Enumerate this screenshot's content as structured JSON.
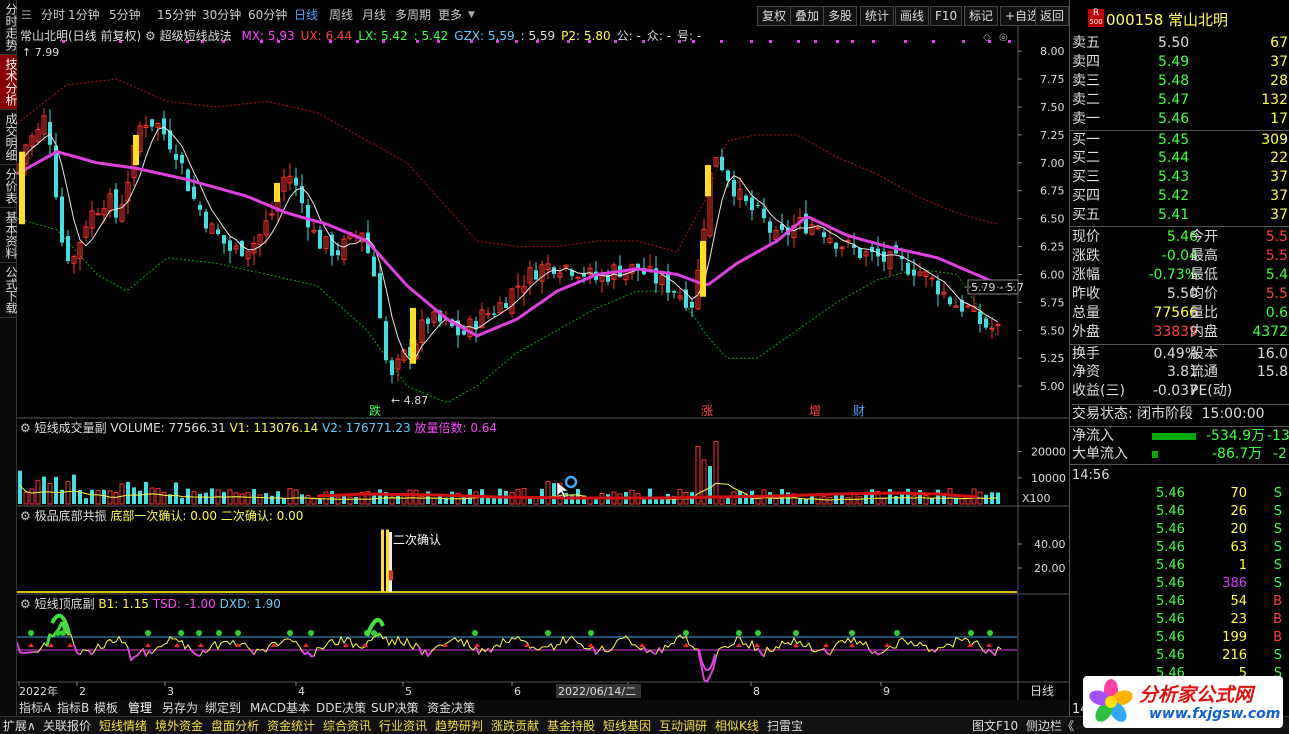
{
  "toolbar": {
    "periods": [
      "分时",
      "1分钟",
      "5分钟",
      "15分钟",
      "30分钟",
      "60分钟",
      "日线",
      "周线",
      "月线",
      "多周期",
      "更多"
    ],
    "active_period": "日线",
    "buttons": [
      "复权",
      "叠加",
      "多股",
      "统计",
      "画线",
      "F10",
      "标记",
      "+自选",
      "返回"
    ]
  },
  "left_tabs": [
    "分时走势",
    "技术分析",
    "成交明细",
    "分价表",
    "基本资料",
    "公式下载"
  ],
  "left_tabs_active": "技术分析",
  "main_panel": {
    "title": "常山北明(日线 前复权)",
    "indicator": "超级短线战法",
    "params": [
      {
        "label": "MX: 5.93",
        "color": "#ff44ff"
      },
      {
        "label": "UX: 6.44",
        "color": "#ff4040"
      },
      {
        "label": "LX: 5.42",
        "color": "#40ff40"
      },
      {
        "label": ": 5.42",
        "color": "#40ff40"
      },
      {
        "label": "GZX: 5.59",
        "color": "#6cf"
      },
      {
        "label": ": 5.59",
        "color": "#ddd"
      },
      {
        "label": "P2: 5.80",
        "color": "#ffff40"
      },
      {
        "label": "公: -",
        "color": "#ddd"
      },
      {
        "label": "众: -",
        "color": "#ddd"
      },
      {
        "label": "号: -",
        "color": "#ddd"
      }
    ],
    "y_ticks": [
      "8.00",
      "7.75",
      "7.50",
      "7.25",
      "7.00",
      "6.75",
      "6.50",
      "6.25",
      "6.00",
      "5.75",
      "5.50",
      "5.25",
      "5.00"
    ],
    "high_label": "7.99",
    "low_label": "4.87",
    "right_label": "5.79 - 5.7",
    "markers": [
      {
        "text": "跌",
        "color": "#40ff40"
      },
      {
        "text": "涨",
        "color": "#ff4040"
      },
      {
        "text": "增",
        "color": "#ff4040"
      },
      {
        "text": "财",
        "color": "#4ea3ff"
      }
    ]
  },
  "volume_panel": {
    "title": "短线成交量副",
    "vol": "VOLUME: 77566.31",
    "v1": "V1: 113076.14",
    "v2": "V2: 176771.23",
    "ratio": "放量倍数: 0.64",
    "y_ticks": [
      "20000",
      "10000"
    ],
    "unit": "X100"
  },
  "bottom_panel": {
    "title": "极品底部共振",
    "first": "底部一次确认: 0.00",
    "second": "二次确认: 0.00",
    "y_ticks": [
      "40.00",
      "20.00"
    ],
    "annotation": "二次确认"
  },
  "osc_panel": {
    "title": "短线顶底副",
    "b1": "B1: 1.15",
    "tsd": "TSD: -1.00",
    "dxd": "DXD: 1.90"
  },
  "x_axis": {
    "labels": [
      "2022年",
      "2",
      "3",
      "4",
      "5",
      "6",
      "7",
      "8",
      "9"
    ],
    "cursor_date": "2022/06/14/二",
    "period": "日线"
  },
  "indicator_tabs": [
    "指标A",
    "指标B",
    "模板",
    "管理",
    "另存为",
    "绑定到",
    "MACD基本",
    "DDE决策",
    "SUP决策",
    "资金决策"
  ],
  "active_indicator_tab": "管理",
  "bottom_menu": [
    "扩展∧",
    "关联报价",
    "短线情绪",
    "境外资金",
    "盘面分析",
    "资金统计",
    "综合资讯",
    "行业资讯",
    "趋势研判",
    "涨跌贡献",
    "基金持股",
    "短线基因",
    "互动调研",
    "相似K线",
    "扫雷宝",
    "图文F10",
    "侧边栏《"
  ],
  "quote": {
    "badge_top": "R",
    "badge_bottom": "500",
    "code": "000158",
    "name": "常山北明",
    "asks": [
      {
        "label": "卖五",
        "price": "5.50",
        "vol": "67"
      },
      {
        "label": "卖四",
        "price": "5.49",
        "vol": "37"
      },
      {
        "label": "卖三",
        "price": "5.48",
        "vol": "28"
      },
      {
        "label": "卖二",
        "price": "5.47",
        "vol": "132"
      },
      {
        "label": "卖一",
        "price": "5.46",
        "vol": "17"
      }
    ],
    "bids": [
      {
        "label": "买一",
        "price": "5.45",
        "vol": "309"
      },
      {
        "label": "买二",
        "price": "5.44",
        "vol": "22"
      },
      {
        "label": "买三",
        "price": "5.43",
        "vol": "37"
      },
      {
        "label": "买四",
        "price": "5.42",
        "vol": "37"
      },
      {
        "label": "买五",
        "price": "5.41",
        "vol": "37"
      }
    ],
    "stats": [
      {
        "l1": "现价",
        "v1": "5.46",
        "c1": "#40ff40",
        "l2": "今开",
        "v2": "5.5",
        "c2": "#ff4040"
      },
      {
        "l1": "涨跌",
        "v1": "-0.04",
        "c1": "#40ff40",
        "l2": "最高",
        "v2": "5.5",
        "c2": "#ff4040"
      },
      {
        "l1": "涨幅",
        "v1": "-0.73%",
        "c1": "#40ff40",
        "l2": "最低",
        "v2": "5.4",
        "c2": "#40ff40"
      },
      {
        "l1": "昨收",
        "v1": "5.50",
        "c1": "#ddd",
        "l2": "均价",
        "v2": "5.5",
        "c2": "#ff4040"
      },
      {
        "l1": "总量",
        "v1": "77566",
        "c1": "#ffff40",
        "l2": "量比",
        "v2": "0.6",
        "c2": "#40ff40"
      },
      {
        "l1": "外盘",
        "v1": "33839",
        "c1": "#ff4040",
        "l2": "内盘",
        "v2": "4372",
        "c2": "#40ff40"
      },
      {
        "l1": "换手",
        "v1": "0.49%",
        "c1": "#ddd",
        "l2": "股本",
        "v2": "16.0",
        "c2": "#ddd"
      },
      {
        "l1": "净资",
        "v1": "3.81",
        "c1": "#ddd",
        "l2": "流通",
        "v2": "15.8",
        "c2": "#ddd"
      },
      {
        "l1": "收益(三)",
        "v1": "-0.037",
        "c1": "#ddd",
        "l2": "PE(动)",
        "v2": "",
        "c2": "#ddd"
      }
    ],
    "trade_status": "交易状态: 闭市阶段",
    "trade_time": "15:00:00",
    "net_inflow_label": "净流入",
    "net_inflow_value": "-534.9万",
    "net_inflow_extra": "-13",
    "big_inflow_label": "大单流入",
    "big_inflow_value": "-86.7万",
    "big_inflow_extra": "-2",
    "ticks_time": "14:56",
    "ticks": [
      {
        "price": "5.46",
        "vol": "70",
        "side": "S"
      },
      {
        "price": "5.46",
        "vol": "26",
        "side": "S"
      },
      {
        "price": "5.46",
        "vol": "20",
        "side": "S"
      },
      {
        "price": "5.46",
        "vol": "63",
        "side": "S"
      },
      {
        "price": "5.46",
        "vol": "1",
        "side": "S"
      },
      {
        "price": "5.46",
        "vol": "386",
        "side": "S"
      },
      {
        "price": "5.46",
        "vol": "54",
        "side": "B"
      },
      {
        "price": "5.46",
        "vol": "23",
        "side": "B"
      },
      {
        "price": "5.46",
        "vol": "199",
        "side": "B"
      },
      {
        "price": "5.46",
        "vol": "216",
        "side": "S"
      },
      {
        "price": "5.46",
        "vol": "5",
        "side": "S"
      },
      {
        "price": "5.46",
        "vol": "45",
        "side": "S"
      }
    ],
    "ticks_time2": "14:57"
  },
  "watermark": {
    "title": "分析家公式网",
    "url": "www.fxjgsw.com"
  }
}
